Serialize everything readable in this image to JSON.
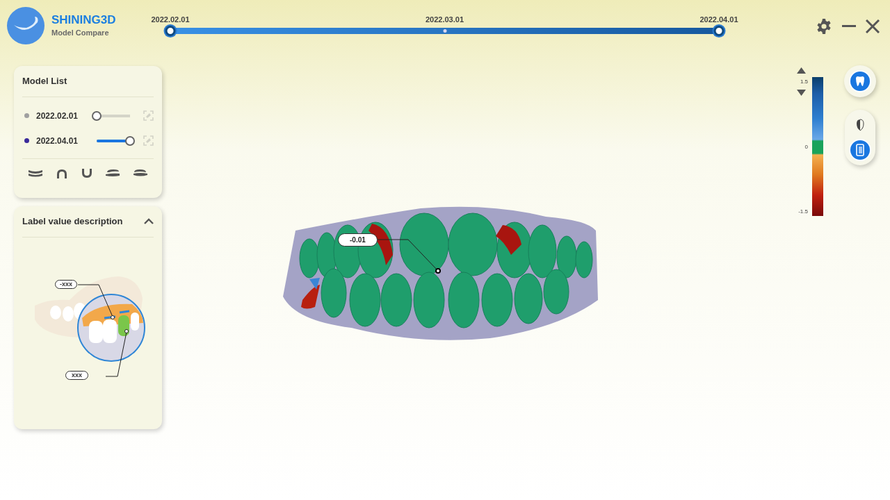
{
  "app": {
    "brand": "SHINING3D",
    "subtitle": "Model Compare"
  },
  "timeline": [
    {
      "label": "2022.02.01",
      "selected": true
    },
    {
      "label": "2022.03.01",
      "selected": false
    },
    {
      "label": "2022.04.01",
      "selected": true
    }
  ],
  "model_list": {
    "title": "Model List",
    "models": [
      {
        "date": "2022.02.01",
        "color": "#a0a0a0",
        "level": 0
      },
      {
        "date": "2022.04.01",
        "color": "#3a2a9a",
        "level": 1
      }
    ]
  },
  "label_panel": {
    "title": "Label value description",
    "expanded": true,
    "callouts": [
      "-xxx",
      "xxx"
    ]
  },
  "color_scale": {
    "labels": [
      "1.5",
      "0",
      "-1.5"
    ]
  },
  "viewport": {
    "measurement": "-0.01"
  },
  "view_buttons": [
    {
      "kind": "single",
      "selected": true
    },
    {
      "kind": "group",
      "selected": false
    },
    {
      "kind": "group",
      "selected": true
    }
  ]
}
